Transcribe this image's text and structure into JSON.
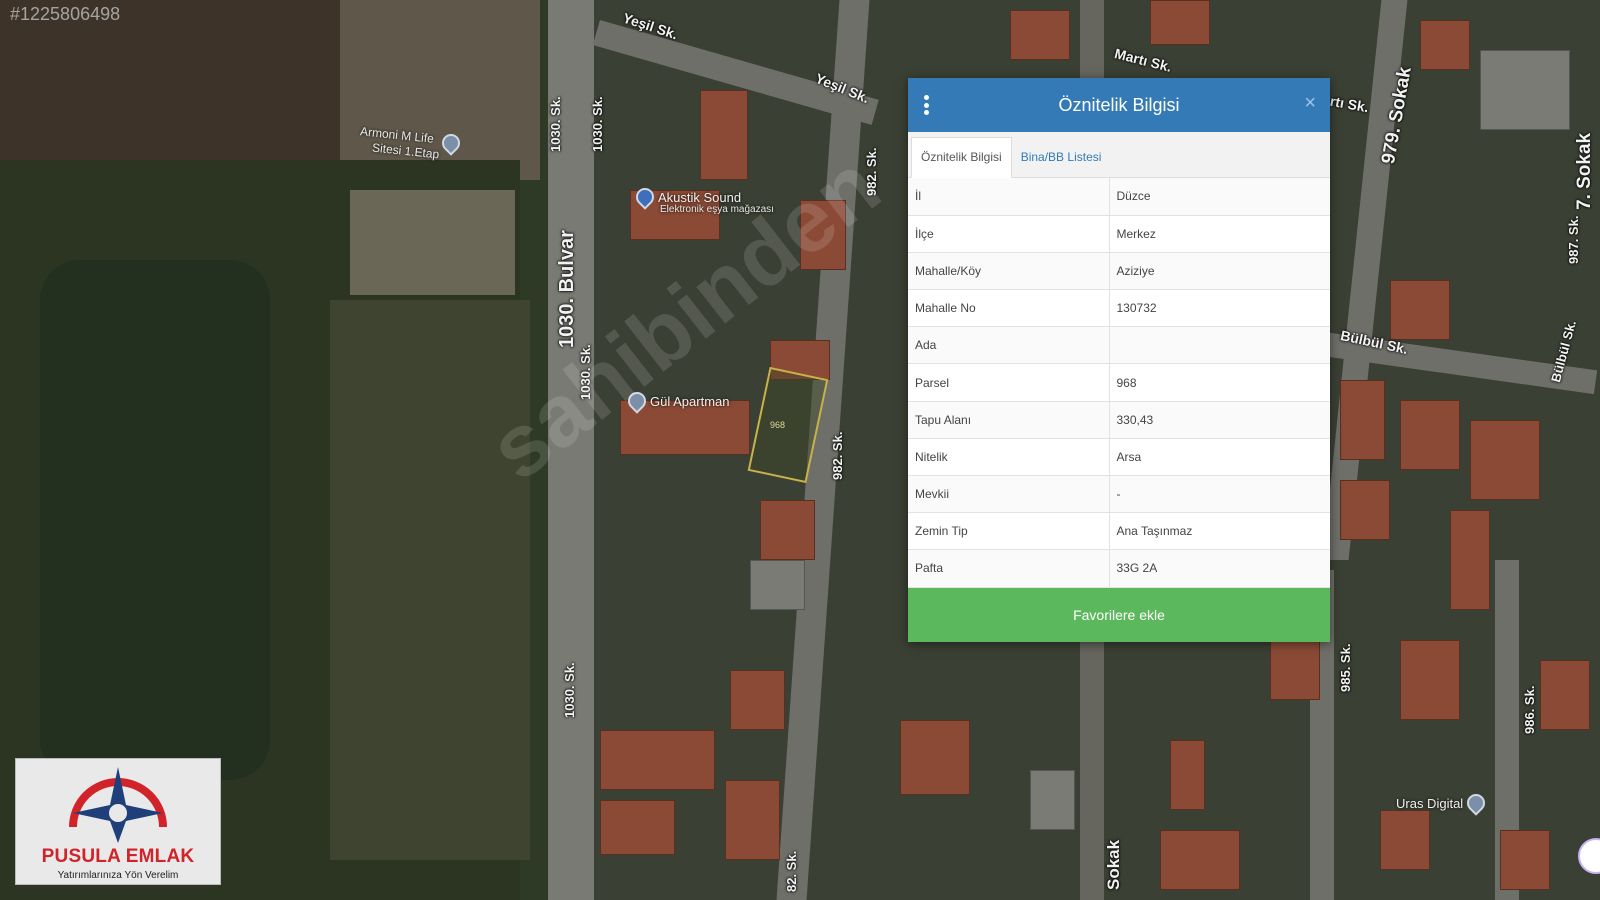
{
  "listing_id": "#1225806498",
  "watermark": "sahibinden",
  "map": {
    "street_labels": [
      "Yeşil Sk.",
      "Yeşil Sk.",
      "1030. Bulvar",
      "1030. Sk.",
      "1030. Sk.",
      "1030. Sk.",
      "1030. Sk.",
      "982. Sk.",
      "982. Sk.",
      "Martı Sk.",
      "rtı Sk.",
      "979. Sokak",
      "Bülbül Sk.",
      "Bülbül Sk.",
      "987. Sk.",
      "7. Sokak",
      "985. Sk.",
      "986. Sk.",
      "Sokak",
      "82. Sk."
    ],
    "pois": {
      "armoni_line1": "Armoni M Life",
      "armoni_line2": "Sitesi 1.Etap",
      "akustik": "Akustik Sound",
      "akustik_sub": "Elektronik eşya mağazası",
      "gul": "Gül Apartman",
      "uras": "Uras Digital"
    },
    "parcel_label": "968"
  },
  "popup": {
    "title": "Öznitelik Bilgisi",
    "menu_icon": "vertical-dots-icon",
    "close_label": "×",
    "tabs": [
      {
        "label": "Öznitelik Bilgisi",
        "active": true
      },
      {
        "label": "Bina/BB Listesi",
        "active": false
      }
    ],
    "rows": [
      {
        "key": "İl",
        "value": "Düzce"
      },
      {
        "key": "İlçe",
        "value": "Merkez"
      },
      {
        "key": "Mahalle/Köy",
        "value": "Aziziye"
      },
      {
        "key": "Mahalle No",
        "value": "130732"
      },
      {
        "key": "Ada",
        "value": ""
      },
      {
        "key": "Parsel",
        "value": "968"
      },
      {
        "key": "Tapu Alanı",
        "value": "330,43"
      },
      {
        "key": "Nitelik",
        "value": "Arsa"
      },
      {
        "key": "Mevkii",
        "value": "-"
      },
      {
        "key": "Zemin Tip",
        "value": "Ana Taşınmaz"
      },
      {
        "key": "Pafta",
        "value": "33G 2A"
      }
    ],
    "favorite_button": "Favorilere ekle",
    "colors": {
      "header": "#337ab7",
      "button": "#5cb85c"
    }
  },
  "logo": {
    "name": "PUSULA EMLAK",
    "tagline": "Yatırımlarınıza Yön Verelim",
    "colors": {
      "red": "#d0232a",
      "navy": "#1f3f7a"
    }
  }
}
